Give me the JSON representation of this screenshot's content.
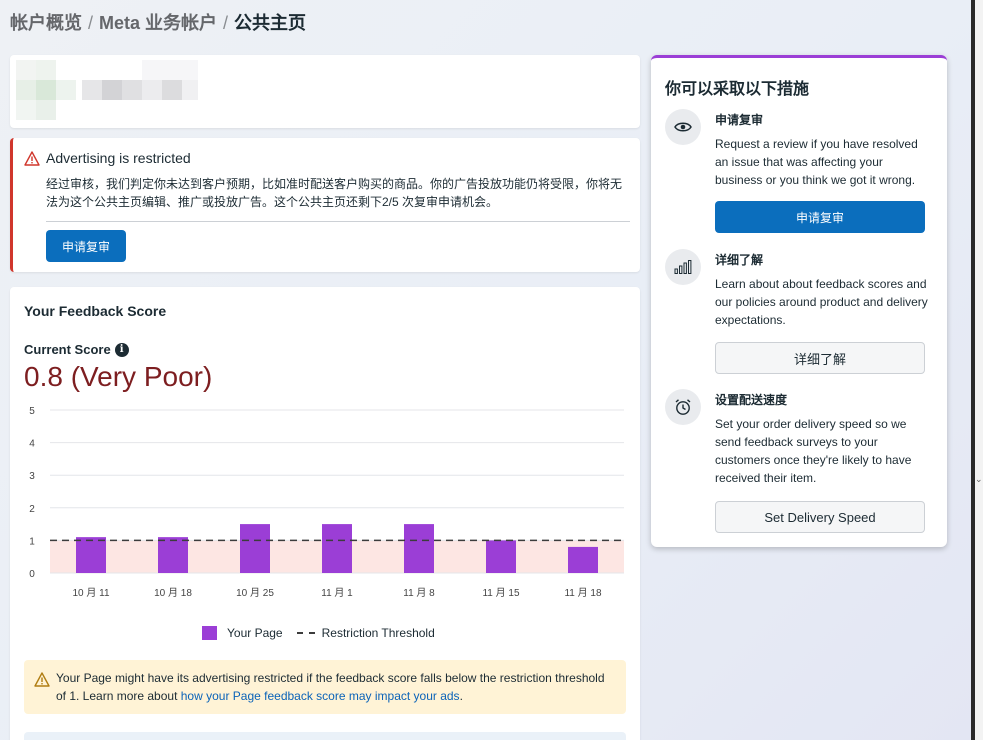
{
  "breadcrumb": {
    "item1": "帐户概览",
    "item2": "Meta 业务帐户",
    "current": "公共主页",
    "separator": "/"
  },
  "restriction": {
    "title": "Advertising is restricted",
    "body": "经过审核，我们判定你未达到客户预期，比如准时配送客户购买的商品。你的广告投放功能仍将受限，你将无法为这个公共主页编辑、推广或投放广告。这个公共主页还剩下2/5 次复审申请机会。",
    "button": "申请复审"
  },
  "feedback": {
    "title": "Your Feedback Score",
    "current_score_label": "Current Score",
    "current_score_value": "0.8 (Very Poor)",
    "legend_page": "Your Page",
    "legend_threshold": "Restriction Threshold",
    "notice_text": "Your Page might have its advertising restricted if the feedback score falls below the restriction threshold of 1. Learn more about ",
    "notice_link": "how your Page feedback score may impact your ads",
    "notice_end": "."
  },
  "chart_data": {
    "type": "bar",
    "categories": [
      "10 月 11",
      "10 月 18",
      "10 月 25",
      "11 月 1",
      "11 月 8",
      "11 月 15",
      "11 月 18"
    ],
    "series": [
      {
        "name": "Your Page",
        "values": [
          1.1,
          1.1,
          1.5,
          1.5,
          1.5,
          1.0,
          0.8
        ],
        "color": "#9b3ed6"
      }
    ],
    "threshold": {
      "name": "Restriction Threshold",
      "value": 1
    },
    "ylim": [
      0,
      5
    ],
    "yticks": [
      0,
      1,
      2,
      3,
      4,
      5
    ],
    "grid": true,
    "legend_placement": "bottom-center",
    "title": "",
    "xlabel": "",
    "ylabel": ""
  },
  "actions": {
    "heading": "你可以采取以下措施",
    "sections": [
      {
        "title": "申请复审",
        "description": "Request a review if you have resolved an issue that was affecting your business or you think we got it wrong.",
        "button": "申请复审",
        "icon": "eye-icon"
      },
      {
        "title": "详细了解",
        "description": "Learn about about feedback scores and our policies around product and delivery expectations.",
        "button": "详细了解",
        "icon": "bar-chart-icon"
      },
      {
        "title": "设置配送速度",
        "description": "Set your order delivery speed so we send feedback surveys to your customers once they're likely to have received their item.",
        "button": "Set Delivery Speed",
        "icon": "alarm-clock-icon"
      }
    ]
  },
  "colors": {
    "accent": "#0b6ebd",
    "purple": "#9b3ed6",
    "danger": "#d0362c",
    "score": "#7d1e20",
    "notice_bg": "#fff3d6"
  }
}
